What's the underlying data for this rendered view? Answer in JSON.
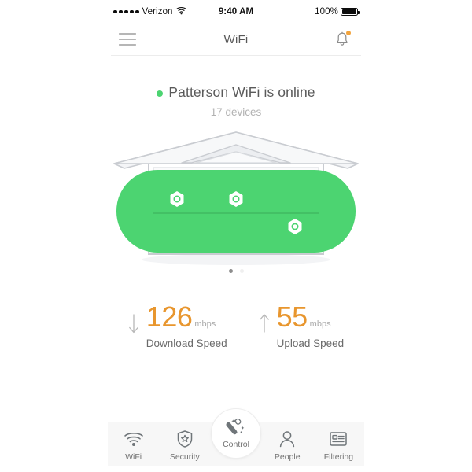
{
  "status_bar": {
    "carrier": "Verizon",
    "signal_icon": "signal-dots-icon",
    "wifi_icon": "wifi-icon",
    "time": "9:40 AM",
    "battery_percent": "100%",
    "battery_icon": "battery-full-icon"
  },
  "nav": {
    "menu_icon": "hamburger-menu-icon",
    "title": "WiFi",
    "notifications_icon": "bell-icon",
    "has_notification_badge": true,
    "badge_color": "#f2a33c"
  },
  "network": {
    "status_text": "Patterson WiFi is online",
    "status_dot_color": "#4cd471",
    "devices_count": "17 devices"
  },
  "illustration": {
    "name": "house-wifi-coverage-illustration",
    "coverage_color": "#4cd471",
    "house_color": "#f4f5f7",
    "outline_color": "#c9ccd1",
    "node_count": 3
  },
  "pager": {
    "total": 2,
    "active_index": 0,
    "active_color": "#8d8d8d",
    "inactive_color": "#efefef"
  },
  "speeds": [
    {
      "arrow_icon": "arrow-down-icon",
      "value": "126",
      "unit": "mbps",
      "label": "Download Speed",
      "color": "#e8962e"
    },
    {
      "arrow_icon": "arrow-up-icon",
      "value": "55",
      "unit": "mbps",
      "label": "Upload Speed",
      "color": "#e8962e"
    }
  ],
  "tabs": [
    {
      "label": "WiFi",
      "icon": "wifi-signal-icon",
      "active": false
    },
    {
      "label": "Security",
      "icon": "shield-star-icon",
      "active": false
    },
    {
      "label": "Control",
      "icon": "magic-wand-icon",
      "active": true
    },
    {
      "label": "People",
      "icon": "person-icon",
      "active": false
    },
    {
      "label": "Filtering",
      "icon": "list-card-icon",
      "active": false
    }
  ]
}
